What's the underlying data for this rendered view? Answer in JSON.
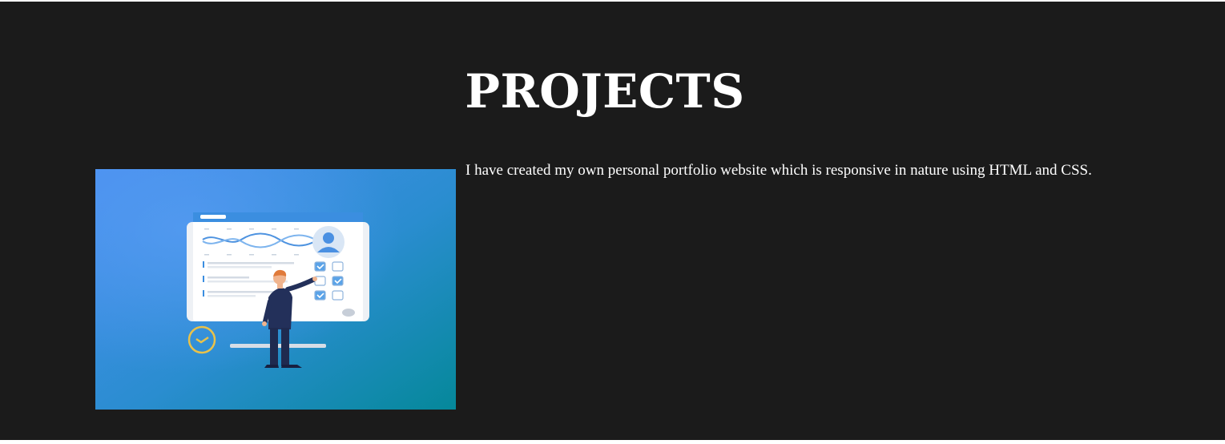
{
  "projects": {
    "title": "PROJECTS",
    "items": [
      {
        "description": "I have created my own personal portfolio website which is responsive in nature using HTML and CSS.",
        "image_icon": "dashboard-illustration-icon"
      }
    ]
  },
  "colors": {
    "background": "#1b1b1b",
    "text": "#ffffff",
    "image_gradient_start": "#4a8ff0",
    "image_gradient_end": "#05889a"
  }
}
